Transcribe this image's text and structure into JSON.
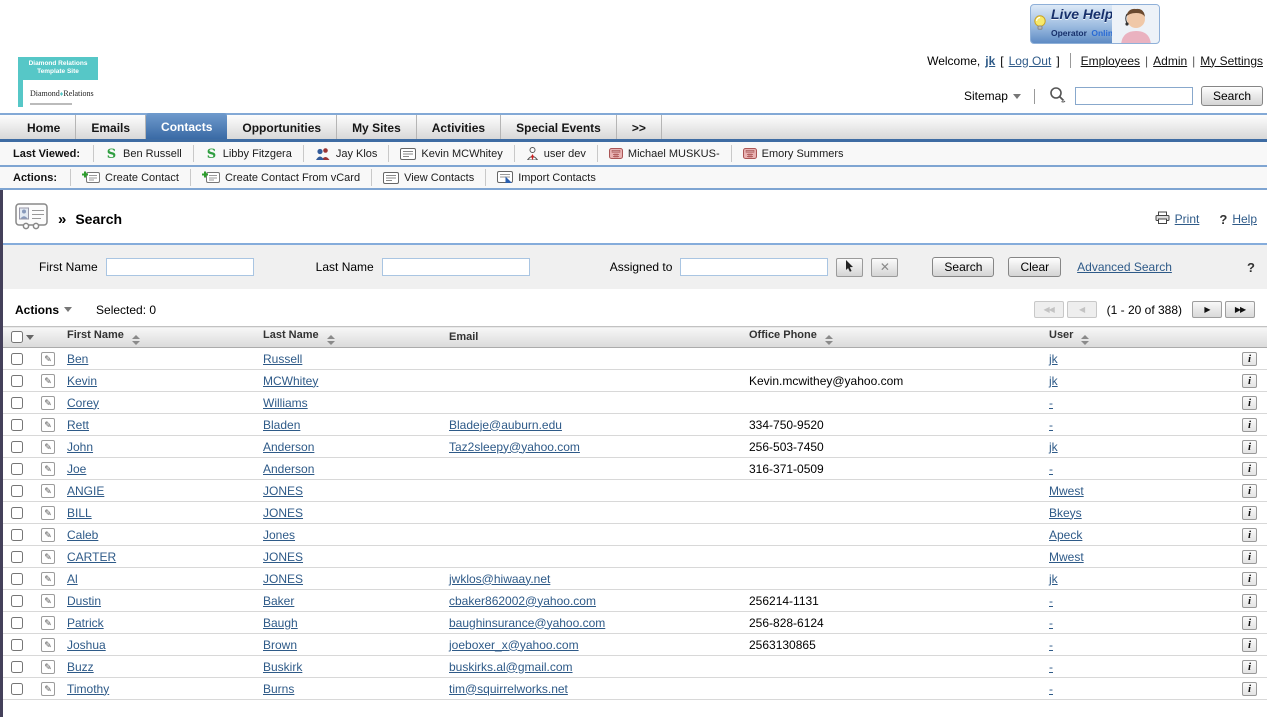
{
  "colors": {
    "accent_blue": "#3e6ca3",
    "link_blue": "#2e5a88",
    "brand_teal": "#56c7c7",
    "bar_border_blue": "#7fa5d2"
  },
  "header": {
    "live_help": {
      "title": "Live Help",
      "operator": "Operator",
      "status": "Online"
    },
    "welcome": {
      "prefix": "Welcome,",
      "user": "jk",
      "bracket_open": "[",
      "logout": "Log Out",
      "bracket_close": "]"
    },
    "links": [
      "Employees",
      "Admin",
      "My Settings"
    ],
    "logo": {
      "top_line1": "Diamond Relations",
      "top_line2": "Template Site",
      "brand_left": "Diamond",
      "diamond": "♦",
      "brand_right": "Relations"
    },
    "sitemap_label": "Sitemap",
    "global_search": {
      "value": "",
      "button": "Search"
    }
  },
  "nav": {
    "active": "Contacts",
    "tabs": [
      "Home",
      "Emails",
      "Contacts",
      "Opportunities",
      "My Sites",
      "Activities",
      "Special Events",
      ">>"
    ]
  },
  "last_viewed": {
    "label": "Last Viewed:",
    "items": [
      {
        "label": "Ben Russell",
        "icon": "sugar-icon"
      },
      {
        "label": "Libby Fitzgera",
        "icon": "sugar-icon"
      },
      {
        "label": "Jay Klos",
        "icon": "people-icon"
      },
      {
        "label": "Kevin MCWhitey",
        "icon": "card-icon"
      },
      {
        "label": "user dev",
        "icon": "user-icon"
      },
      {
        "label": "Michael MUSKUS-",
        "icon": "phone-icon"
      },
      {
        "label": "Emory Summers",
        "icon": "phone-icon"
      }
    ]
  },
  "actions_bar": {
    "label": "Actions:",
    "items": [
      {
        "label": "Create Contact",
        "icon": "create-contact-icon"
      },
      {
        "label": "Create Contact From vCard",
        "icon": "create-contact-icon"
      },
      {
        "label": "View Contacts",
        "icon": "card-icon"
      },
      {
        "label": "Import Contacts",
        "icon": "import-icon"
      }
    ]
  },
  "page": {
    "breadcrumb_symbol": "»",
    "title": "Search",
    "print": "Print",
    "help": "Help"
  },
  "search_form": {
    "first_name": {
      "label": "First Name",
      "value": ""
    },
    "last_name": {
      "label": "Last Name",
      "value": ""
    },
    "assigned_to": {
      "label": "Assigned to",
      "value": ""
    },
    "search_button": "Search",
    "clear_button": "Clear",
    "advanced_search": "Advanced Search",
    "help_symbol": "?"
  },
  "list": {
    "actions_label": "Actions",
    "selected_label": "Selected: 0",
    "pagination": {
      "range": "(1 - 20 of 388)"
    },
    "columns": [
      {
        "label": "First Name",
        "sortable": true
      },
      {
        "label": "Last Name",
        "sortable": true
      },
      {
        "label": "Email",
        "sortable": false
      },
      {
        "label": "Office Phone",
        "sortable": true
      },
      {
        "label": "User",
        "sortable": true
      }
    ],
    "rows": [
      {
        "first_name": "Ben",
        "last_name": "Russell",
        "email": "",
        "office_phone": "",
        "user": "jk"
      },
      {
        "first_name": "Kevin",
        "last_name": "MCWhitey",
        "email": "",
        "office_phone": "Kevin.mcwithey@yahoo.com",
        "user": "jk"
      },
      {
        "first_name": "Corey",
        "last_name": "Williams",
        "email": "",
        "office_phone": "",
        "user": "-"
      },
      {
        "first_name": "Rett",
        "last_name": "Bladen",
        "email": "Bladeje@auburn.edu",
        "office_phone": "334-750-9520",
        "user": "-"
      },
      {
        "first_name": "John",
        "last_name": "Anderson",
        "email": "Taz2sleepy@yahoo.com",
        "office_phone": "256-503-7450",
        "user": "jk"
      },
      {
        "first_name": "Joe",
        "last_name": "Anderson",
        "email": "",
        "office_phone": "316-371-0509",
        "user": "-"
      },
      {
        "first_name": "ANGIE",
        "last_name": "JONES",
        "email": "",
        "office_phone": "",
        "user": "Mwest"
      },
      {
        "first_name": "BILL",
        "last_name": "JONES",
        "email": "",
        "office_phone": "",
        "user": "Bkeys"
      },
      {
        "first_name": "Caleb",
        "last_name": "Jones",
        "email": "",
        "office_phone": "",
        "user": "Apeck"
      },
      {
        "first_name": "CARTER",
        "last_name": "JONES",
        "email": "",
        "office_phone": "",
        "user": "Mwest"
      },
      {
        "first_name": "Al",
        "last_name": "JONES",
        "email": "jwklos@hiwaay.net",
        "office_phone": "",
        "user": "jk"
      },
      {
        "first_name": "Dustin",
        "last_name": "Baker",
        "email": "cbaker862002@yahoo.com",
        "office_phone": "256214-1131",
        "user": "-"
      },
      {
        "first_name": "Patrick",
        "last_name": "Baugh",
        "email": "baughinsurance@yahoo.com",
        "office_phone": "256-828-6124",
        "user": "-"
      },
      {
        "first_name": "Joshua",
        "last_name": "Brown",
        "email": "joeboxer_x@yahoo.com",
        "office_phone": "2563130865",
        "user": "-"
      },
      {
        "first_name": "Buzz",
        "last_name": "Buskirk",
        "email": "buskirks.al@gmail.com",
        "office_phone": "",
        "user": "-"
      },
      {
        "first_name": "Timothy",
        "last_name": "Burns",
        "email": "tim@squirrelworks.net",
        "office_phone": "",
        "user": "-"
      }
    ]
  }
}
